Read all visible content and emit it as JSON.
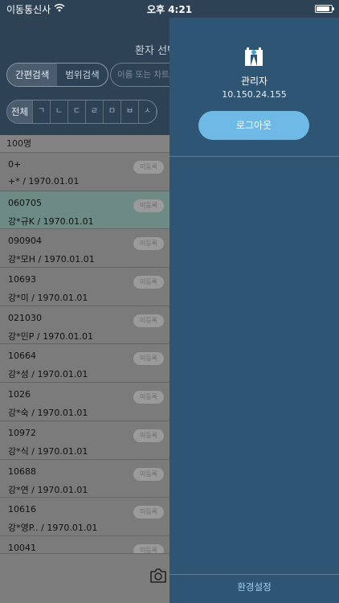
{
  "status": {
    "carrier": "이동통신사",
    "time": "오후 4:21",
    "battery_level": 0.9
  },
  "header": {
    "title": "환자 선택",
    "segments": [
      "간편검색",
      "범위검색"
    ],
    "search_placeholder": "이름 또는 차트번호",
    "index": [
      "전체",
      "ㄱ",
      "ㄴ",
      "ㄷ",
      "ㄹ",
      "ㅁ",
      "ㅂ",
      "ㅅ"
    ]
  },
  "list": {
    "count": "100명",
    "badge": "미등록",
    "rows": [
      {
        "id": "0+",
        "info": "+*  /  1970.01.01"
      },
      {
        "id": "060705",
        "info": "강*규K  /  1970.01.01"
      },
      {
        "id": "090904",
        "info": "강*모H  /  1970.01.01"
      },
      {
        "id": "10693",
        "info": "강*미  /  1970.01.01"
      },
      {
        "id": "021030",
        "info": "강*민P  /  1970.01.01"
      },
      {
        "id": "10664",
        "info": "강*성  /  1970.01.01"
      },
      {
        "id": "1026",
        "info": "강*숙  /  1970.01.01"
      },
      {
        "id": "10972",
        "info": "강*식  /  1970.01.01"
      },
      {
        "id": "10688",
        "info": "강*연  /  1970.01.01"
      },
      {
        "id": "10616",
        "info": "강*영P..  /  1970.01.01"
      },
      {
        "id": "10041",
        "info": ""
      }
    ]
  },
  "drawer": {
    "role": "관리자",
    "ip": "10.150.24.155",
    "logout_label": "로그아웃",
    "settings_label": "환경설정"
  },
  "colors": {
    "drawer_bg": "#2f5575",
    "logout_button": "#6fb9e6",
    "settings_text": "#9fd0f2"
  },
  "icons": {
    "logo": "hospital-logo-icon",
    "camera": "camera-icon",
    "wifi": "wifi-icon",
    "battery": "battery-icon"
  }
}
